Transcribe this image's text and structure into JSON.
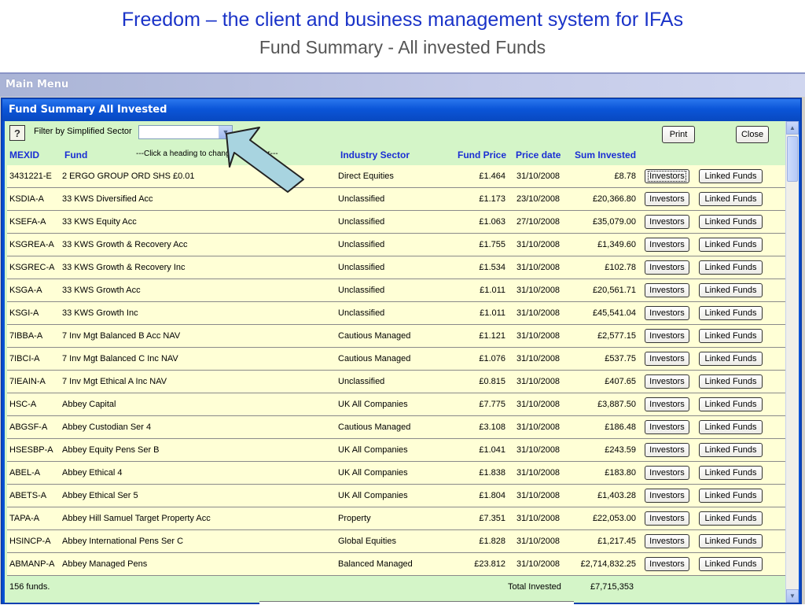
{
  "slide": {
    "title": "Freedom – the client and business management system for IFAs",
    "subtitle": "Fund Summary - All invested Funds"
  },
  "main_menu": {
    "title": "Main Menu"
  },
  "window": {
    "title": "Fund Summary All Invested"
  },
  "toolbar": {
    "help_icon": "?",
    "filter_label": "Filter by Simplified Sector",
    "filter_value": "",
    "print_label": "Print",
    "close_label": "Close"
  },
  "headers": {
    "mexid": "MEXID",
    "fund": "Fund",
    "hint": "---Click a heading to change sort order---",
    "sector": "Industry Sector",
    "price": "Fund Price",
    "date": "Price date",
    "sum": "Sum Invested"
  },
  "row_buttons": {
    "investors": "Investors",
    "linked": "Linked Funds"
  },
  "rows": [
    {
      "mexid": "3431221-E",
      "fund": "2 ERGO GROUP ORD SHS £0.01",
      "sector": "Direct Equities",
      "price": "£1.464",
      "date": "31/10/2008",
      "sum": "£8.78"
    },
    {
      "mexid": "KSDIA-A",
      "fund": "33 KWS Diversified Acc",
      "sector": "Unclassified",
      "price": "£1.173",
      "date": "23/10/2008",
      "sum": "£20,366.80"
    },
    {
      "mexid": "KSEFA-A",
      "fund": "33 KWS Equity Acc",
      "sector": "Unclassified",
      "price": "£1.063",
      "date": "27/10/2008",
      "sum": "£35,079.00"
    },
    {
      "mexid": "KSGREA-A",
      "fund": "33 KWS Growth & Recovery Acc",
      "sector": "Unclassified",
      "price": "£1.755",
      "date": "31/10/2008",
      "sum": "£1,349.60"
    },
    {
      "mexid": "KSGREC-A",
      "fund": "33 KWS Growth & Recovery Inc",
      "sector": "Unclassified",
      "price": "£1.534",
      "date": "31/10/2008",
      "sum": "£102.78"
    },
    {
      "mexid": "KSGA-A",
      "fund": "33 KWS Growth Acc",
      "sector": "Unclassified",
      "price": "£1.011",
      "date": "31/10/2008",
      "sum": "£20,561.71"
    },
    {
      "mexid": "KSGI-A",
      "fund": "33 KWS Growth Inc",
      "sector": "Unclassified",
      "price": "£1.011",
      "date": "31/10/2008",
      "sum": "£45,541.04"
    },
    {
      "mexid": "7IBBA-A",
      "fund": "7 Inv Mgt Balanced B Acc NAV",
      "sector": "Cautious Managed",
      "price": "£1.121",
      "date": "31/10/2008",
      "sum": "£2,577.15"
    },
    {
      "mexid": "7IBCI-A",
      "fund": "7 Inv Mgt Balanced C Inc NAV",
      "sector": "Cautious Managed",
      "price": "£1.076",
      "date": "31/10/2008",
      "sum": "£537.75"
    },
    {
      "mexid": "7IEAIN-A",
      "fund": "7 Inv Mgt Ethical A Inc NAV",
      "sector": "Unclassified",
      "price": "£0.815",
      "date": "31/10/2008",
      "sum": "£407.65"
    },
    {
      "mexid": "HSC-A",
      "fund": "Abbey Capital",
      "sector": "UK All Companies",
      "price": "£7.775",
      "date": "31/10/2008",
      "sum": "£3,887.50"
    },
    {
      "mexid": "ABGSF-A",
      "fund": "Abbey Custodian Ser 4",
      "sector": "Cautious Managed",
      "price": "£3.108",
      "date": "31/10/2008",
      "sum": "£186.48"
    },
    {
      "mexid": "HSESBP-A",
      "fund": "Abbey Equity Pens Ser B",
      "sector": "UK All Companies",
      "price": "£1.041",
      "date": "31/10/2008",
      "sum": "£243.59"
    },
    {
      "mexid": "ABEL-A",
      "fund": "Abbey Ethical 4",
      "sector": "UK All Companies",
      "price": "£1.838",
      "date": "31/10/2008",
      "sum": "£183.80"
    },
    {
      "mexid": "ABETS-A",
      "fund": "Abbey Ethical Ser 5",
      "sector": "UK All Companies",
      "price": "£1.804",
      "date": "31/10/2008",
      "sum": "£1,403.28"
    },
    {
      "mexid": "TAPA-A",
      "fund": "Abbey Hill Samuel Target Property Acc",
      "sector": "Property",
      "price": "£7.351",
      "date": "31/10/2008",
      "sum": "£22,053.00"
    },
    {
      "mexid": "HSINCP-A",
      "fund": "Abbey International Pens Ser C",
      "sector": "Global Equities",
      "price": "£1.828",
      "date": "31/10/2008",
      "sum": "£1,217.45"
    },
    {
      "mexid": "ABMANP-A",
      "fund": "Abbey Managed Pens",
      "sector": "Balanced Managed",
      "price": "£23.812",
      "date": "31/10/2008",
      "sum": "£2,714,832.25"
    }
  ],
  "footer": {
    "count": "156 funds.",
    "total_label": "Total Invested",
    "total_value": "£7,715,353"
  },
  "colors": {
    "title_blue": "#1a33c8",
    "header_blue": "#1a2ed4",
    "row_bg": "#ffffd6",
    "form_bg": "#d4f5c8",
    "titlebar_blue": "#0852d6",
    "callout_arrow": "#a8d4e0"
  },
  "icons": {
    "help": "question-icon",
    "dropdown": "chevron-down-icon",
    "scroll_up": "scroll-up-icon",
    "scroll_down": "scroll-down-icon",
    "callout": "callout-arrow-icon"
  }
}
